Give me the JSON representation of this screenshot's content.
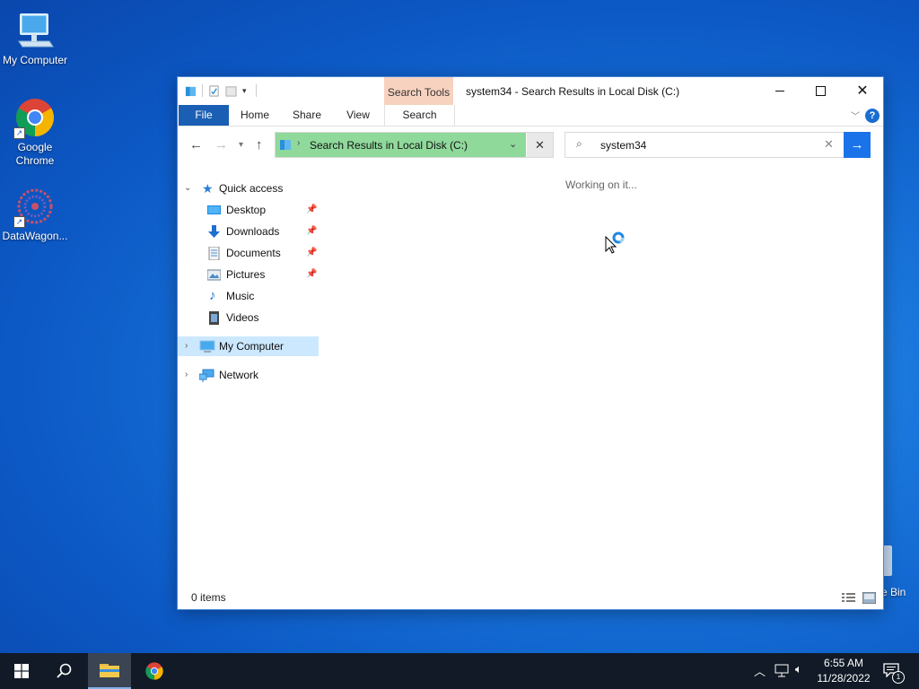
{
  "desktop": {
    "icons": [
      {
        "label": "My Computer"
      },
      {
        "label": "Google Chrome"
      },
      {
        "label": "DataWagon..."
      }
    ],
    "recycle_partial_label": "e Bin"
  },
  "window": {
    "search_tools_label": "Search Tools",
    "title": "system34 - Search Results in Local Disk (C:)",
    "tabs": {
      "file": "File",
      "home": "Home",
      "share": "Share",
      "view": "View",
      "search": "Search"
    },
    "help": "?",
    "address": "Search Results in Local Disk (C:)",
    "search_value": "system34",
    "status_message": "Working on it...",
    "item_count": "0 items"
  },
  "nav": {
    "quick_access": "Quick access",
    "items": [
      {
        "label": "Desktop",
        "pinned": true
      },
      {
        "label": "Downloads",
        "pinned": true
      },
      {
        "label": "Documents",
        "pinned": true
      },
      {
        "label": "Pictures",
        "pinned": true
      },
      {
        "label": "Music",
        "pinned": false
      },
      {
        "label": "Videos",
        "pinned": false
      }
    ],
    "my_computer": "My Computer",
    "network": "Network"
  },
  "taskbar": {
    "time": "6:55 AM",
    "date": "11/28/2022",
    "notification_count": "1"
  },
  "colors": {
    "accent": "#1a5fb4",
    "address_fill": "#8fd99b",
    "search_tools_tab": "#f7d2bf",
    "selection": "#cce8ff"
  }
}
